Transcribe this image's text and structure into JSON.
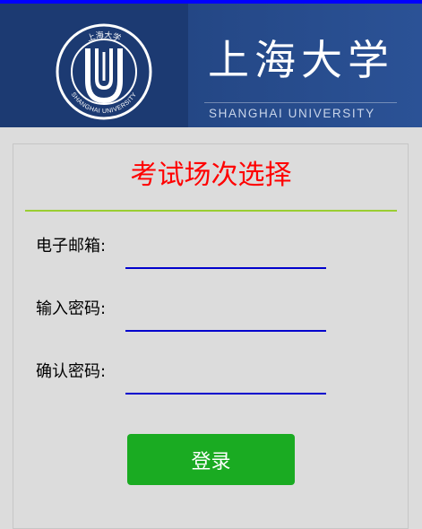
{
  "header": {
    "emblem_icon": "shanghai-university-emblem",
    "banner_cn": "上海大学",
    "banner_en": "SHANGHAI UNIVERSITY",
    "emblem_top_text": "上海大学",
    "emblem_bottom_text": "SHANGHAI UNIVERSITY"
  },
  "form": {
    "title": "考试场次选择",
    "fields": [
      {
        "label": "电子邮箱:",
        "value": "",
        "placeholder": ""
      },
      {
        "label": "输入密码:",
        "value": "",
        "placeholder": ""
      },
      {
        "label": "确认密码:",
        "value": "",
        "placeholder": ""
      }
    ],
    "submit_label": "登录"
  },
  "colors": {
    "top_strip": "#0000ff",
    "header_bg": "#244785",
    "page_bg": "#dcdcdc",
    "title": "#ff0000",
    "title_rule": "#9acd32",
    "input_underline": "#0000cd",
    "button_bg": "#1aab22"
  }
}
